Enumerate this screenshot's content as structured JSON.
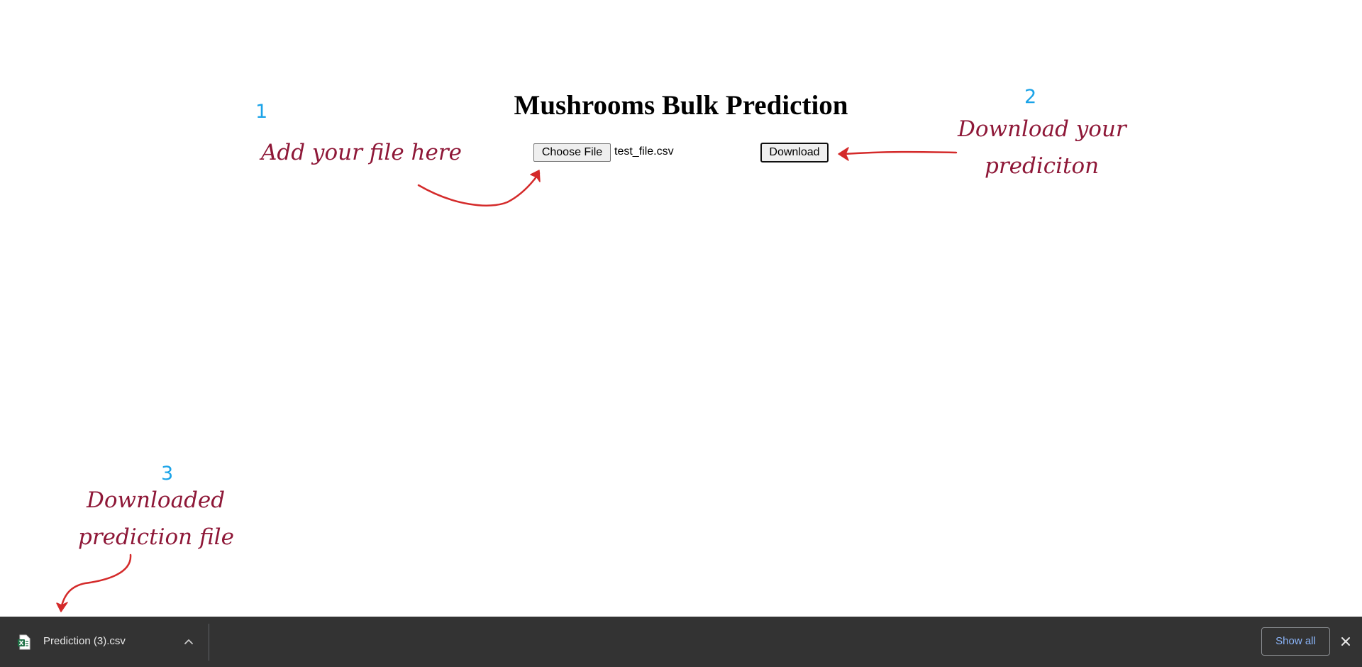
{
  "page": {
    "title": "Mushrooms Bulk Prediction",
    "choose_file_label": "Choose File",
    "selected_file": "test_file.csv",
    "download_label": "Download"
  },
  "annotations": {
    "step1": {
      "number": "1",
      "text": "Add your file here"
    },
    "step2": {
      "number": "2",
      "line1": "Download your",
      "line2": "prediciton"
    },
    "step3": {
      "number": "3",
      "line1": "Downloaded",
      "line2": "prediction file"
    },
    "colors": {
      "text": "#8e1737",
      "number": "#1aa3e8",
      "arrow": "#d42a2a"
    }
  },
  "download_shelf": {
    "item_name": "Prediction (3).csv",
    "item_icon": "excel-csv-file-icon",
    "show_all_label": "Show all",
    "colors": {
      "background": "#333333",
      "link": "#8ab4f8"
    }
  }
}
